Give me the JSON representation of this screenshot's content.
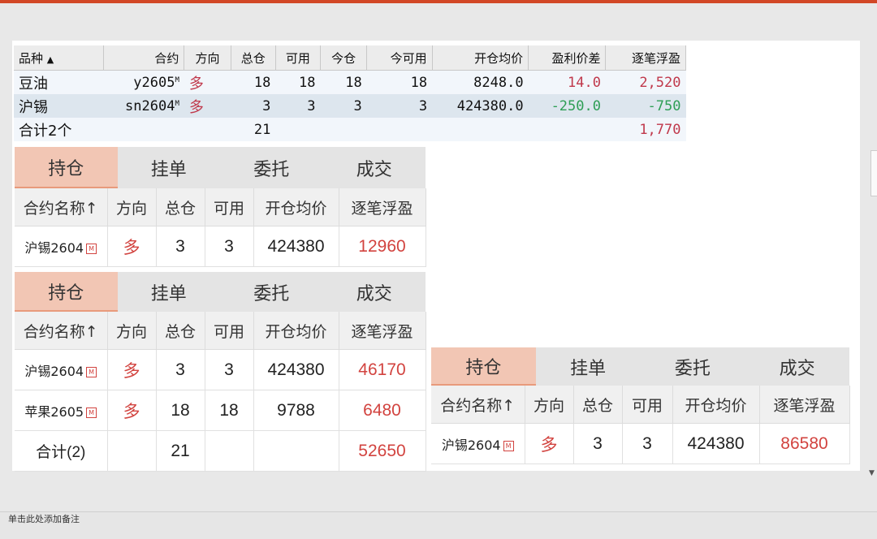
{
  "trade_table": {
    "headers": [
      "品种",
      "合约",
      "方向",
      "总仓",
      "可用",
      "今仓",
      "今可用",
      "开仓均价",
      "盈利价差",
      "逐笔浮盈"
    ],
    "rows": [
      {
        "variety": "豆油",
        "contract": "y2605",
        "badge": "M",
        "direction": "多",
        "total": "18",
        "available": "18",
        "today": "18",
        "today_available": "18",
        "avg_price": "8248.0",
        "price_diff": "14.0",
        "floating_pl": "2,520"
      },
      {
        "variety": "沪锡",
        "contract": "sn2604",
        "badge": "M",
        "direction": "多",
        "total": "3",
        "available": "3",
        "today": "3",
        "today_available": "3",
        "avg_price": "424380.0",
        "price_diff": "-250.0",
        "floating_pl": "-750"
      }
    ],
    "summary": {
      "label": "合计2个",
      "total": "21",
      "floating_pl": "1,770"
    }
  },
  "panels": {
    "tabs": [
      "持仓",
      "挂单",
      "委托",
      "成交"
    ],
    "headers": [
      "合约名称↑",
      "方向",
      "总仓",
      "可用",
      "开仓均价",
      "逐笔浮盈"
    ],
    "badge": "M",
    "panel1": {
      "rows": [
        {
          "name": "沪锡2604",
          "direction": "多",
          "total": "3",
          "available": "3",
          "avg_price": "424380",
          "floating_pl": "12960"
        }
      ]
    },
    "panel2": {
      "rows": [
        {
          "name": "沪锡2604",
          "direction": "多",
          "total": "3",
          "available": "3",
          "avg_price": "424380",
          "floating_pl": "46170"
        },
        {
          "name": "苹果2605",
          "direction": "多",
          "total": "18",
          "available": "18",
          "avg_price": "9788",
          "floating_pl": "6480"
        }
      ],
      "summary": {
        "label": "合计(2)",
        "total": "21",
        "floating_pl": "52650"
      }
    },
    "panel3": {
      "rows": [
        {
          "name": "沪锡2604",
          "direction": "多",
          "total": "3",
          "available": "3",
          "avg_price": "424380",
          "floating_pl": "86580"
        }
      ]
    }
  },
  "notes_placeholder": "单击此处添加备注",
  "colors": {
    "accent": "#d24726",
    "profit_red": "#c0384b",
    "loss_green": "#2e9e55",
    "active_tab": "#f2c6b4"
  }
}
